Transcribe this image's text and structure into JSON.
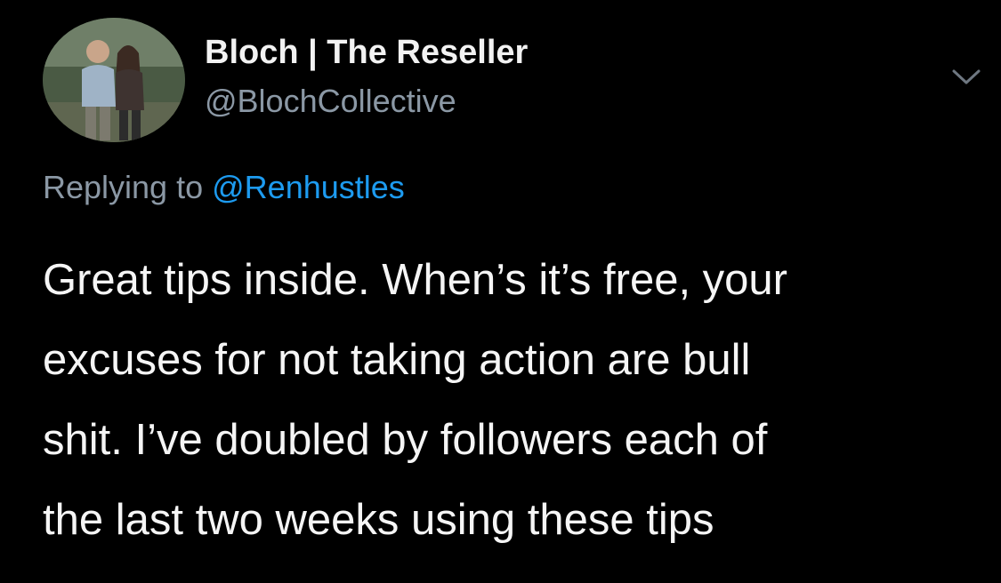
{
  "tweet": {
    "author": {
      "display_name": "Bloch | The Reseller",
      "handle": "@BlochCollective",
      "avatar_icon": "profile-photo"
    },
    "menu_icon": "chevron-down-icon",
    "reply": {
      "prefix": "Replying to",
      "mention": "@Renhustles"
    },
    "text_lines": [
      "Great tips inside. When’s it’s free, your",
      "excuses for not taking action are bull",
      "shit. I’ve doubled by followers each of",
      "the last two weeks using these tips"
    ]
  },
  "colors": {
    "background": "#000000",
    "name": "#f2f2f2",
    "secondary": "#8b98a5",
    "link": "#1d9bf0",
    "body": "#f5f5f5"
  }
}
